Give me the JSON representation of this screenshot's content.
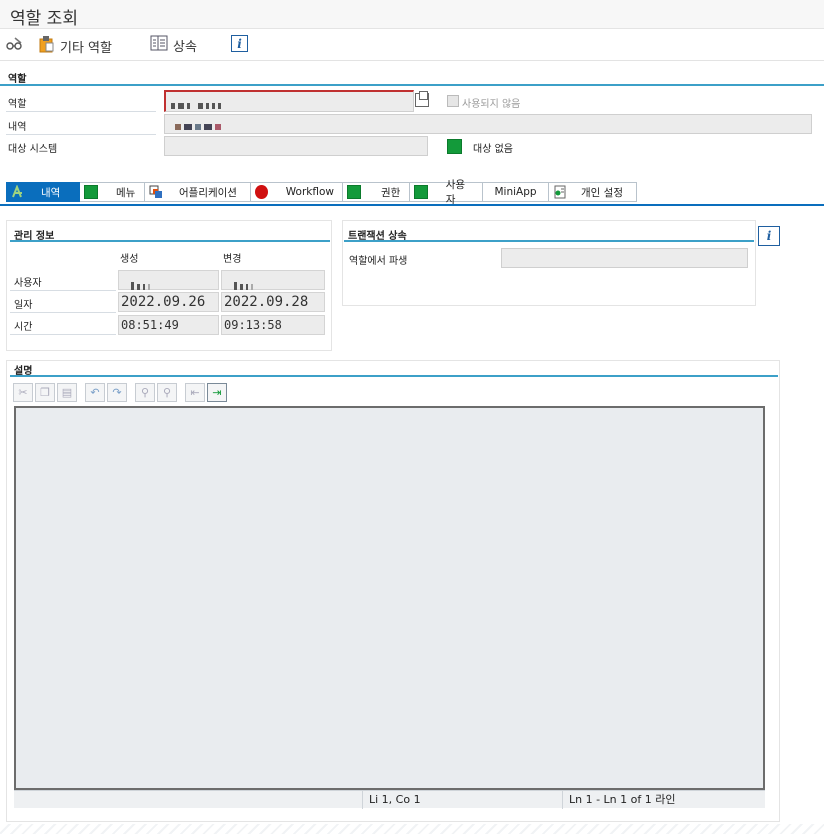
{
  "window": {
    "title": "역할 조회"
  },
  "toolbar": {
    "other_role": "기타 역할",
    "inherit": "상속"
  },
  "role_group": {
    "title": "역할",
    "role_label": "역할",
    "desc_label": "내역",
    "target_system_label": "대상 시스템",
    "unused_checkbox_label": "사용되지 않음",
    "no_target_label": "대상 없음"
  },
  "tabs": [
    {
      "label": "내역",
      "icon": "description-icon",
      "active": true
    },
    {
      "label": "메뉴",
      "icon": "green-status-icon"
    },
    {
      "label": "어플리케이션",
      "icon": "application-icon"
    },
    {
      "label": "Workflow",
      "icon": "red-status-icon"
    },
    {
      "label": "권한",
      "icon": "green-status-icon"
    },
    {
      "label": "사용자",
      "icon": "green-status-icon"
    },
    {
      "label": "MiniApp",
      "icon": "none"
    },
    {
      "label": "개인 설정",
      "icon": "personalization-icon"
    }
  ],
  "admin_info": {
    "title": "관리 정보",
    "col_created": "생성",
    "col_changed": "변경",
    "row_user": "사용자",
    "row_date": "일자",
    "row_time": "시간",
    "created_date": "2022.09.26",
    "changed_date": "2022.09.28",
    "created_time": "08:51:49",
    "changed_time": "09:13:58"
  },
  "transaction_inherit": {
    "title": "트랜잭션 상속",
    "derived_label": "역할에서 파생"
  },
  "description": {
    "title": "설명",
    "status_position": "Li 1, Co 1",
    "status_lines": "Ln 1 - Ln 1 of 1 라인"
  },
  "colors": {
    "accent_blue": "#0a6ebd",
    "group_line": "#3ca0c8",
    "status_green": "#139a3a",
    "status_red": "#d01010"
  }
}
